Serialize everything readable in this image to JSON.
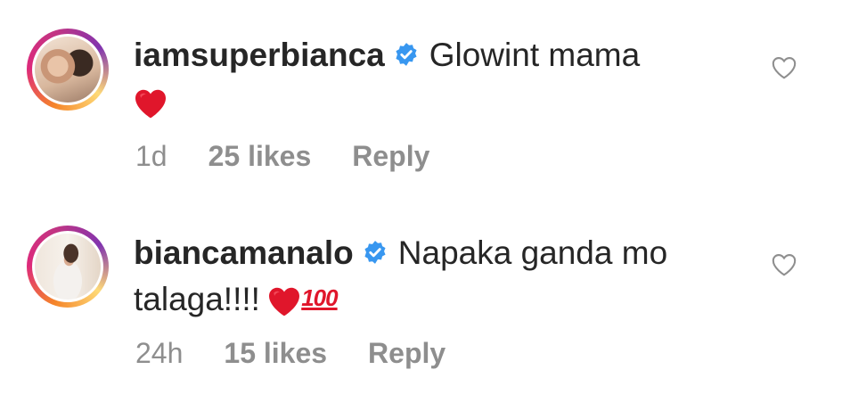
{
  "comments": [
    {
      "username": "iamsuperbianca",
      "text": "Glowint mama",
      "emoji": [
        "red-heart"
      ],
      "time": "1d",
      "likes": "25 likes",
      "reply_label": "Reply",
      "verified": true
    },
    {
      "username": "biancamanalo",
      "text_line1": "Napaka ganda mo",
      "text_line2": "talaga!!!!",
      "emoji": [
        "red-heart",
        "hundred-points"
      ],
      "hundred_text": "100",
      "time": "24h",
      "likes": "15 likes",
      "reply_label": "Reply",
      "verified": true
    }
  ],
  "colors": {
    "text": "#262626",
    "meta": "#8e8e8e",
    "verified": "#3897f0",
    "heart": "#e0162b"
  }
}
